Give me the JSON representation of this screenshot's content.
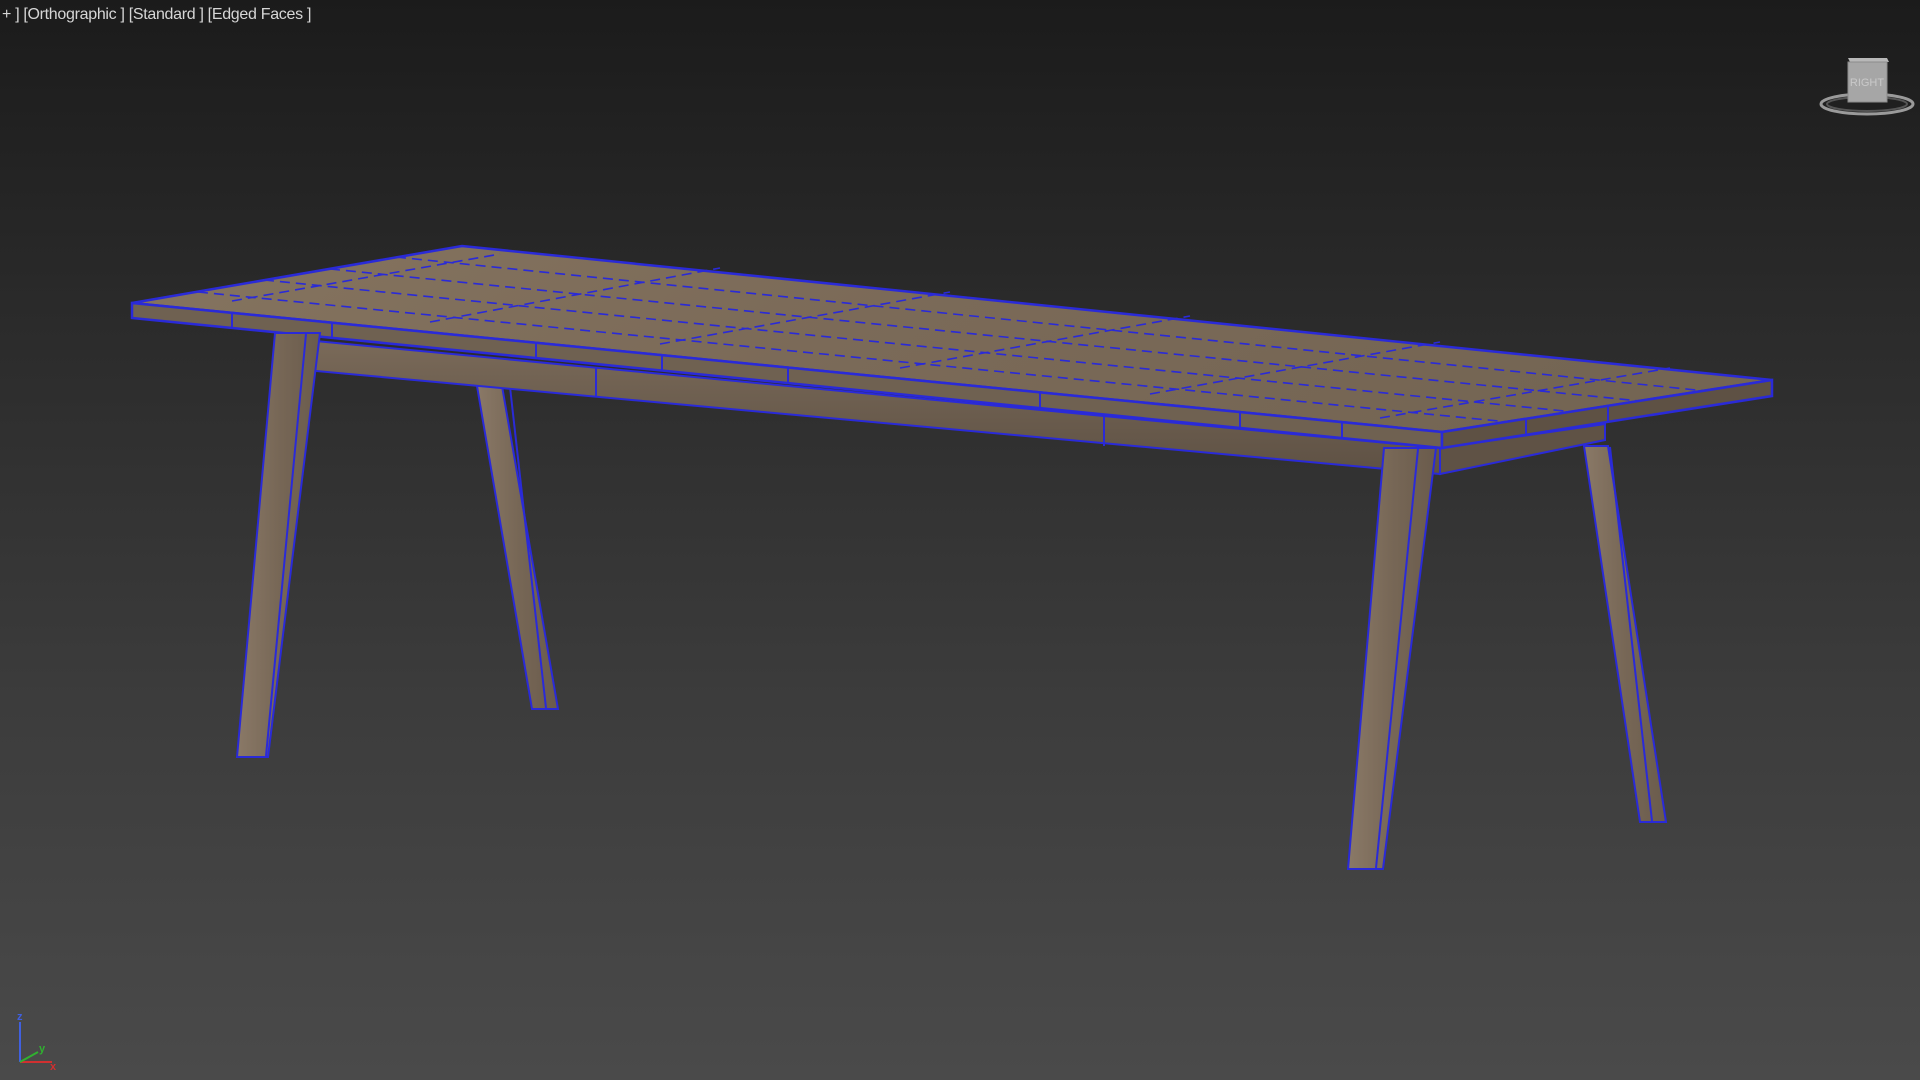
{
  "viewport": {
    "plus_menu": "+ ]",
    "view_mode": "[Orthographic ]",
    "shading_mode": "[Standard ]",
    "edge_mode": "[Edged Faces ]"
  },
  "viewcube": {
    "face_label": "RIGHT",
    "icon": "viewcube-icon"
  },
  "axis_tripod": {
    "z_label": "z",
    "x_label": "x",
    "y_label": "y",
    "colors": {
      "x": "#d03030",
      "y": "#30b030",
      "z": "#4060e0"
    }
  },
  "scene": {
    "object": "table-mesh",
    "colors": {
      "wood_top": "#7d6d5e",
      "wood_side": "#6a5a4c",
      "wood_leg": "#7a6a5b",
      "wire_edge": "#2a2ad8",
      "background_top": "#1b1b1b",
      "background_bottom": "#4a4a4a"
    }
  }
}
